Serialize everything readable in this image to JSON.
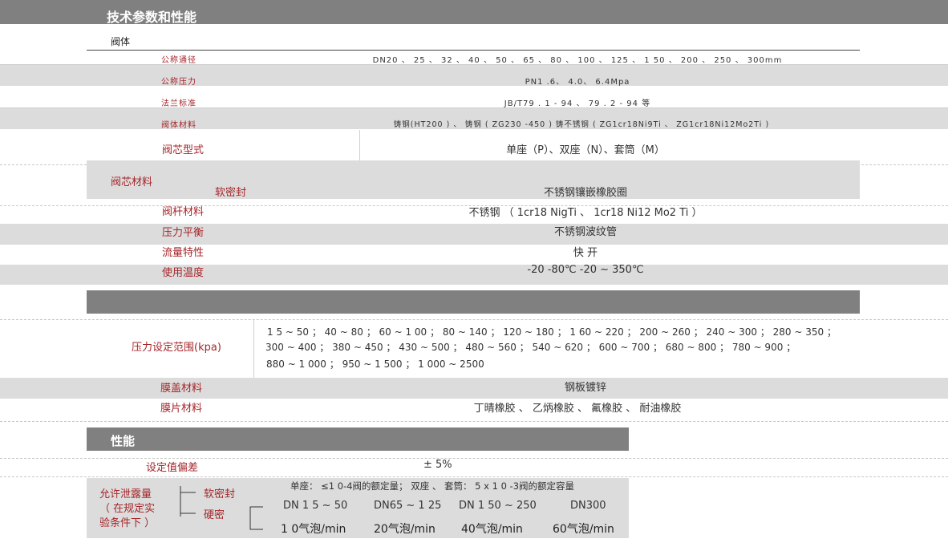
{
  "header": {
    "title": "技术参数和性能"
  },
  "valve_body": {
    "section_label": "阀体",
    "rows": [
      {
        "label": "公称通径",
        "value": "DN20 、 25 、 32 、 40 、 50 、 65 、 80 、 100 、 125 、 1 50 、 200 、 250 、 300mm"
      },
      {
        "label": "公称压力",
        "value": "PN1 .6、 4.0、 6.4Mpa"
      },
      {
        "label": "法兰标准",
        "value": "JB/T79 . 1 - 94 、 79 . 2 - 94 等"
      },
      {
        "label": "阀体材料",
        "value": "铸钢(HT200 ) 、 铸钢 ( ZG230 -450 ) 铸不锈钢 ( ZG1cr18Ni9Ti 、 ZG1cr18Ni12Mo2Ti )"
      }
    ]
  },
  "valve_core": {
    "core_type": {
      "label": "阀芯型式",
      "value": "单座（P）、双座（N）、套筒（M）"
    },
    "core_material": {
      "label": "阀芯材料",
      "sub_label": "软密封",
      "value": "不锈钢镶嵌橡胶圈"
    },
    "stem_material": {
      "label": "阀杆材料",
      "value": "不锈钢 （ 1cr18 NigTi 、 1cr18 Ni12 Mo2 Ti ）"
    },
    "pressure_balance": {
      "label": "压力平衡",
      "value": "不锈钢波纹管"
    },
    "flow_char": {
      "label": "流量特性",
      "value": "快 开"
    },
    "temp": {
      "label": "使用温度",
      "value": "-20 -80℃ -20 ~ 350℃"
    }
  },
  "actuator": {
    "pressure_range": {
      "label": "压力设定范围(kpa)",
      "lines": [
        "1 5 ~ 50 ； 40 ~ 80 ； 60 ~ 1 00 ； 80 ~ 140 ； 120 ~ 180 ； 1 60 ~ 220 ； 200 ~ 260 ； 240 ~ 300 ； 280 ~ 350 ；",
        "300 ~ 400 ； 380 ~ 450 ； 430 ~ 500 ； 480 ~ 560 ； 540 ~ 620 ； 600 ~ 700 ； 680 ~ 800 ； 780 ~ 900 ；",
        "880 ~ 1 000 ； 950 ~ 1 500 ； 1 000 ~ 2500"
      ]
    },
    "diaphragm_cover": {
      "label": "膜盖材料",
      "value": "钢板镀锌"
    },
    "diaphragm": {
      "label": "膜片材料",
      "value": "丁晴橡胶 、 乙炳橡胶 、 氟橡胶 、 耐油橡胶"
    }
  },
  "performance": {
    "title": "性能",
    "set_deviation": {
      "label": "设定值偏差",
      "value": "± 5%"
    },
    "leakage": {
      "label_lines": [
        "允许泄露量",
        "（ 在规定实",
        "验条件下 ）"
      ],
      "soft_seal": "软密封",
      "hard_seal": "硬密",
      "soft_value": "单座： ≤1 0-4阀的额定量； 双座 、 套筒： 5 x 1 0 -3阀的额定容量",
      "dn_headers": [
        "DN 1 5 ~ 50",
        "DN65 ~ 1 25",
        "DN 1 50 ~ 250",
        "DN300"
      ],
      "bubble_values": [
        "1 0气泡/min",
        "20气泡/min",
        "40气泡/min",
        "60气泡/min"
      ]
    }
  }
}
